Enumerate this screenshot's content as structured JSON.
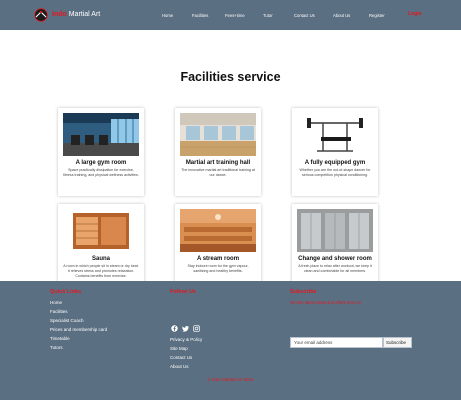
{
  "brand": {
    "name_red": "Indo",
    "name_white": " Martial Art"
  },
  "nav": {
    "links": [
      "Home",
      "Facilities",
      "Fees+time",
      "Tutor",
      "Contact Us",
      "About Us",
      "Register"
    ],
    "cta": "Login"
  },
  "page": {
    "title": "Facilities service"
  },
  "cards": [
    {
      "title": "A large gym room",
      "desc": "Space practically dissipation for exercise, fitness training, and physical wellness activities."
    },
    {
      "title": "Martial art training hall",
      "desc": "The innovative martial art traditional training at our dance."
    },
    {
      "title": "A fully equipped gym",
      "desc": "Whether you are the out-of-shape dancer for serious competition physical conditioning."
    },
    {
      "title": "Sauna",
      "desc": "A room in which people sit in steam or dry heat. It relieves stress and promotes relaxation. Contains benefits from exercise."
    },
    {
      "title": "A stream room",
      "desc": "Stay indoors room for the gym vapour, sanitizing and healthy benefits."
    },
    {
      "title": "Change and shower room",
      "desc": "A fresh place to relax after workout, we keep it clean and comfortable for all members."
    }
  ],
  "footer": {
    "quick_links_heading": "Quick Links",
    "quick_links": [
      "Home",
      "Facilities",
      "Specialist Coach",
      "Prices and membership card",
      "Timetable",
      "Tutors"
    ],
    "follow_heading": "Follow Us",
    "follow_links": [
      "Privacy & Policy",
      "Site Map",
      "Contact Us",
      "About Us"
    ],
    "subscribe_heading": "Subscribe",
    "subscribe_text": "Get the latest news and offers from us",
    "email_placeholder": "Your email address",
    "subscribe_button": "Subscribe",
    "copyright": "© Indo Martial Art 2021"
  },
  "colors": {
    "nav_bg": "#5b6f82",
    "accent": "#e0191f"
  },
  "icons": [
    "logo-icon",
    "facebook-icon",
    "twitter-icon",
    "instagram-icon"
  ]
}
